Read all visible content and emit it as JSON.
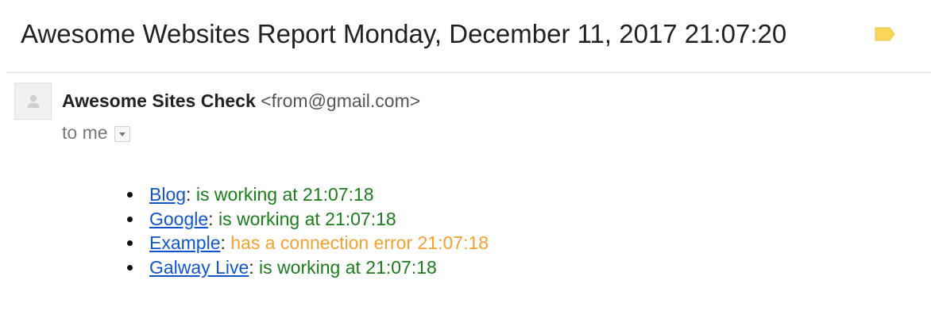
{
  "email": {
    "subject": "Awesome Websites Report Monday, December 11, 2017 21:07:20",
    "label_color": "#f9d55a",
    "sender": {
      "name": "Awesome Sites Check",
      "email": "<from@gmail.com>",
      "avatar_icon": "person-icon"
    },
    "recipient_line": "to me",
    "details_icon": "chevron-down-icon"
  },
  "report": {
    "separator": ":",
    "items": [
      {
        "link": "Blog",
        "status": " is working at 21:07:18",
        "status_color": "#1a7d1a"
      },
      {
        "link": "Google",
        "status": " is working at 21:07:18",
        "status_color": "#1a7d1a"
      },
      {
        "link": "Example",
        "status": " has a connection error 21:07:18",
        "status_color": "#f4a12f"
      },
      {
        "link": "Galway Live",
        "status": " is working at 21:07:18",
        "status_color": "#1a7d1a"
      }
    ]
  }
}
